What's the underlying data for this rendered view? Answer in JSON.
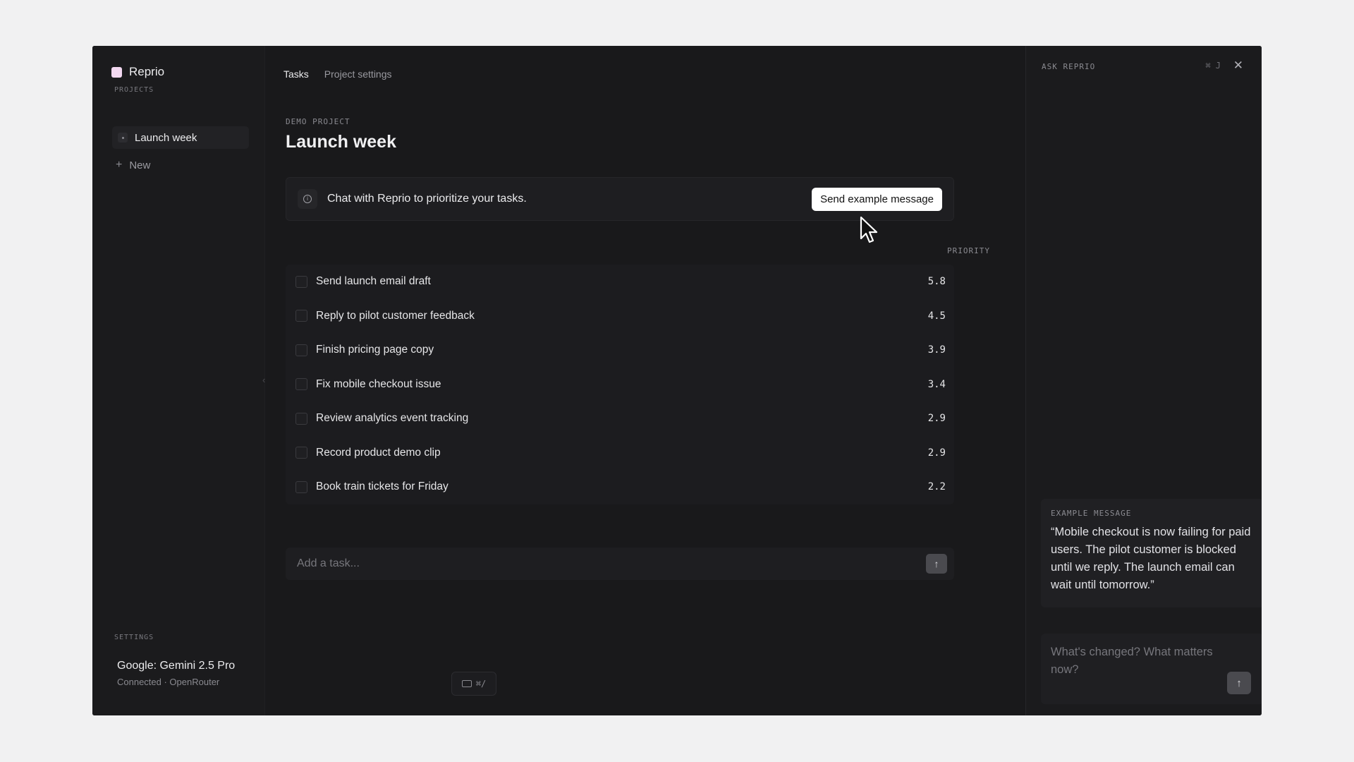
{
  "app": {
    "name": "Reprio"
  },
  "sidebar": {
    "projects_label": "PROJECTS",
    "projects": [
      {
        "label": "Launch week"
      }
    ],
    "new_label": "New",
    "settings_label": "SETTINGS",
    "model_name": "Google: Gemini 2.5 Pro",
    "model_status": "Connected · OpenRouter"
  },
  "tabs": [
    {
      "label": "Tasks",
      "active": true
    },
    {
      "label": "Project settings",
      "active": false
    }
  ],
  "main": {
    "eyebrow": "DEMO PROJECT",
    "title": "Launch week",
    "banner_text": "Chat with Reprio to prioritize your tasks.",
    "banner_button": "Send example message",
    "priority_header": "PRIORITY",
    "tasks": [
      {
        "title": "Send launch email draft",
        "priority": "5.8"
      },
      {
        "title": "Reply to pilot customer feedback",
        "priority": "4.5"
      },
      {
        "title": "Finish pricing page copy",
        "priority": "3.9"
      },
      {
        "title": "Fix mobile checkout issue",
        "priority": "3.4"
      },
      {
        "title": "Review analytics event tracking",
        "priority": "2.9"
      },
      {
        "title": "Record product demo clip",
        "priority": "2.9"
      },
      {
        "title": "Book train tickets for Friday",
        "priority": "2.2"
      }
    ],
    "add_task_placeholder": "Add a task...",
    "shortcut_hint": "⌘/"
  },
  "ask_panel": {
    "title": "ASK REPRIO",
    "shortcut": "⌘ J",
    "example_label": "EXAMPLE MESSAGE",
    "example_text": "“Mobile checkout is now failing for paid users. The pilot customer is blocked until we reply. The launch email can wait until tomorrow.”",
    "input_placeholder": "What's changed? What matters now?"
  },
  "colors": {
    "accent_logo": "#f2d8f0",
    "button_bg": "#ffffff",
    "window_bg": "#19191b"
  }
}
